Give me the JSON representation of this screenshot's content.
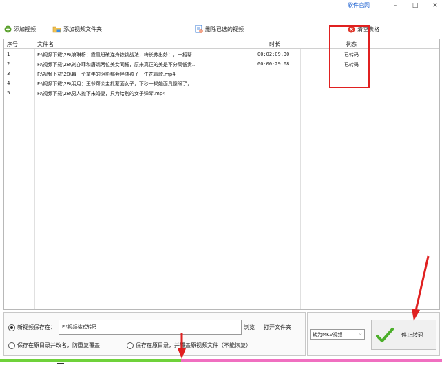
{
  "titlebar": {
    "official_site": "软件官网",
    "minimize": "–",
    "maximize": "□",
    "close": "×"
  },
  "toolbar": {
    "add_video": "添加视频",
    "add_folder": "添加视频文件夹",
    "delete_selected": "删除已选的视频",
    "clear_table": "清空表格"
  },
  "table": {
    "headers": {
      "num": "序号",
      "name": "文件名",
      "duration": "时长",
      "status": "状态"
    },
    "rows": [
      {
        "num": "1",
        "name": "F:\\视频下载\\28\\浪琳榜：霞凰班破连舟铁锁战法，梅长苏出妙计，一招帮...",
        "duration": "00:02:09.30",
        "status": "已转码"
      },
      {
        "num": "2",
        "name": "F:\\视频下载\\28\\刘亦菲和唐嫣两位美女同框，原来真正的美是不分高低贵...",
        "duration": "00:00:29.08",
        "status": "已转码"
      },
      {
        "num": "3",
        "name": "F:\\视频下载\\28\\每一个童年的阴影都会伴随孩子一生花青歌.mp4",
        "duration": "",
        "status": ""
      },
      {
        "num": "4",
        "name": "F:\\视频下载\\28\\明月：王爷帮公主抓蒙面女子，下秒一揭她面具傻眼了，...",
        "duration": "",
        "status": ""
      },
      {
        "num": "5",
        "name": "F:\\视频下载\\28\\男人抛下未婚妻，只为给别的女子弹琴.mp4",
        "duration": "",
        "status": ""
      }
    ]
  },
  "save": {
    "new_dir_label": "新视频保存在：",
    "path_value": "F:\\视频格式转码",
    "browse": "浏览",
    "open_folder": "打开文件夹",
    "original_rename": "保存在原目录并改名，防重复覆盖",
    "original_overwrite": "保存在原目录，并覆盖原视频文件（不能恢复）"
  },
  "convert": {
    "format": "转为MKV视频",
    "stop": "停止转码"
  },
  "progress": {
    "fraction": 0.41
  },
  "colors": {
    "accent_link": "#1a5fd0",
    "highlight": "#e02020",
    "progress_done": "#6fd23a",
    "progress_remaining": "#f06fc0"
  }
}
